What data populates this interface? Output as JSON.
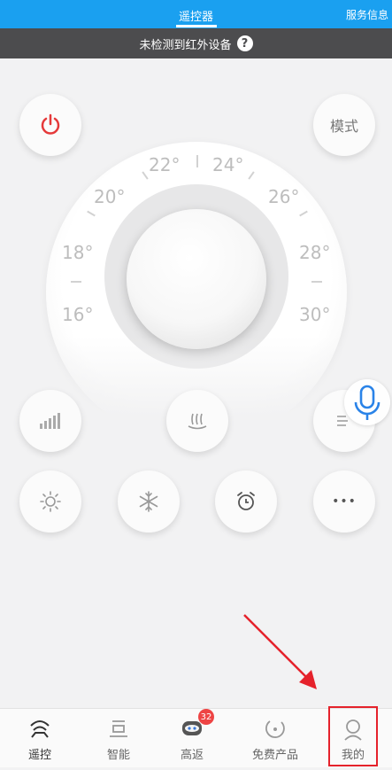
{
  "topbar": {
    "tab_label": "遥控器",
    "service_label": "服务信息"
  },
  "notice": {
    "text": "未检测到红外设备",
    "help_symbol": "?"
  },
  "controls": {
    "mode_label": "模式",
    "more_label": "•••"
  },
  "dial": {
    "temperatures": [
      "16°",
      "18°",
      "20°",
      "22°",
      "24°",
      "26°",
      "28°",
      "30°"
    ]
  },
  "nav": {
    "items": [
      {
        "label": "遥控",
        "icon": "remote-icon"
      },
      {
        "label": "智能",
        "icon": "smart-icon"
      },
      {
        "label": "高返",
        "icon": "robot-icon",
        "badge": "32"
      },
      {
        "label": "免费产品",
        "icon": "free-product-icon"
      },
      {
        "label": "我的",
        "icon": "user-icon"
      }
    ]
  },
  "colors": {
    "topbar": "#1aa0f0",
    "power_red": "#e5393a",
    "mic_blue": "#2a83e8",
    "annotation_red": "#e5222b"
  }
}
